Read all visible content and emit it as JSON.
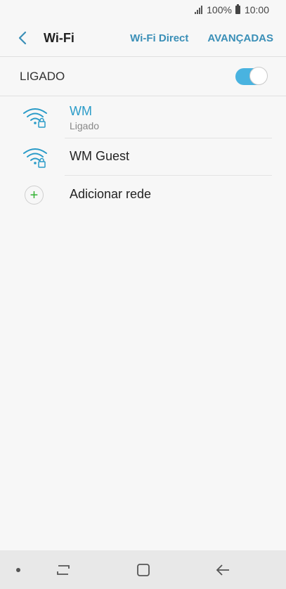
{
  "status_bar": {
    "battery": "100%",
    "time": "10:00"
  },
  "header": {
    "back_icon": "back-arrow-icon",
    "title": "Wi-Fi",
    "wifi_direct": "Wi-Fi Direct",
    "advanced": "AVANÇADAS"
  },
  "master_switch": {
    "label": "LIGADO",
    "on": true
  },
  "networks": [
    {
      "name": "WM",
      "status": "Ligado",
      "secured": true,
      "connected": true
    },
    {
      "name": "WM Guest",
      "status": "",
      "secured": true,
      "connected": false
    }
  ],
  "add_network": {
    "label": "Adicionar rede",
    "icon": "plus-icon"
  },
  "colors": {
    "accent": "#2a9bc8",
    "toggle_on": "#49b3e0",
    "add_green": "#33b233"
  }
}
